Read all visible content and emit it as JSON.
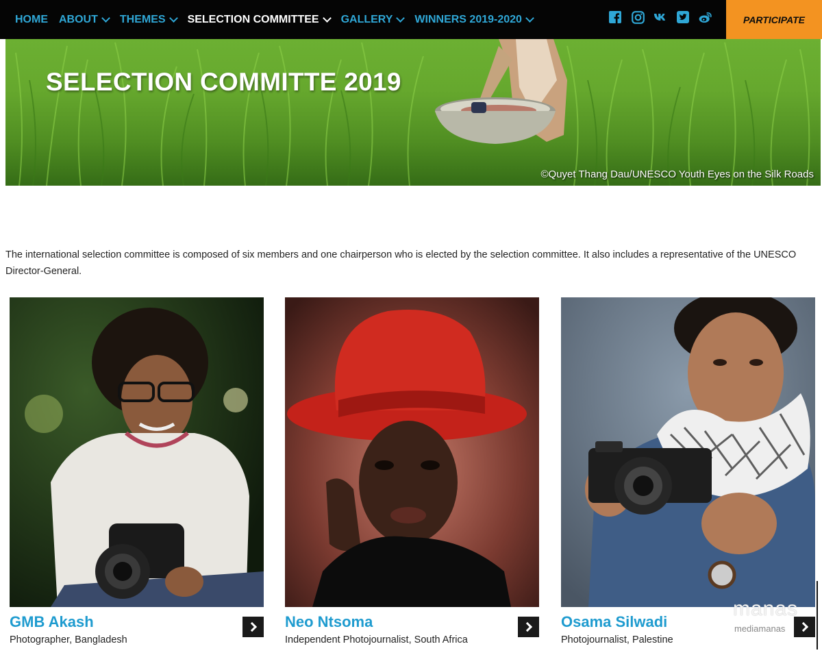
{
  "nav": {
    "items": [
      {
        "label": "HOME",
        "has_dropdown": false,
        "active": false
      },
      {
        "label": "ABOUT",
        "has_dropdown": true,
        "active": false
      },
      {
        "label": "THEMES",
        "has_dropdown": true,
        "active": false
      },
      {
        "label": "SELECTION COMMITTEE",
        "has_dropdown": true,
        "active": true
      },
      {
        "label": "GALLERY",
        "has_dropdown": true,
        "active": false
      },
      {
        "label": "WINNERS 2019-2020",
        "has_dropdown": true,
        "active": false
      }
    ],
    "social": [
      "facebook-icon",
      "instagram-icon",
      "vk-icon",
      "twitter-icon",
      "weibo-icon"
    ],
    "participate_label": "PARTICIPATE",
    "colors": {
      "link": "#2fa7d6",
      "active": "#ffffff",
      "bar": "#050505",
      "cta": "#f39321"
    }
  },
  "hero": {
    "title": "SELECTION COMMITTE 2019",
    "credit": "©Quyet Thang Dau/UNESCO Youth Eyes on the Silk Roads"
  },
  "intro": "The international selection committee is composed of six members and one chairperson who is elected by the selection committee. It also includes a representative of the UNESCO Director-General.",
  "members": [
    {
      "name": "GMB Akash",
      "role": "Photographer, Bangladesh"
    },
    {
      "name": "Neo Ntsoma",
      "role": "Independent Photojournalist, South Africa"
    },
    {
      "name": "Osama Silwadi",
      "role": "Photojournalist, Palestine"
    }
  ],
  "watermark": {
    "text": "manas",
    "sub": "mediamanas"
  },
  "accent": "#1e9bcf"
}
